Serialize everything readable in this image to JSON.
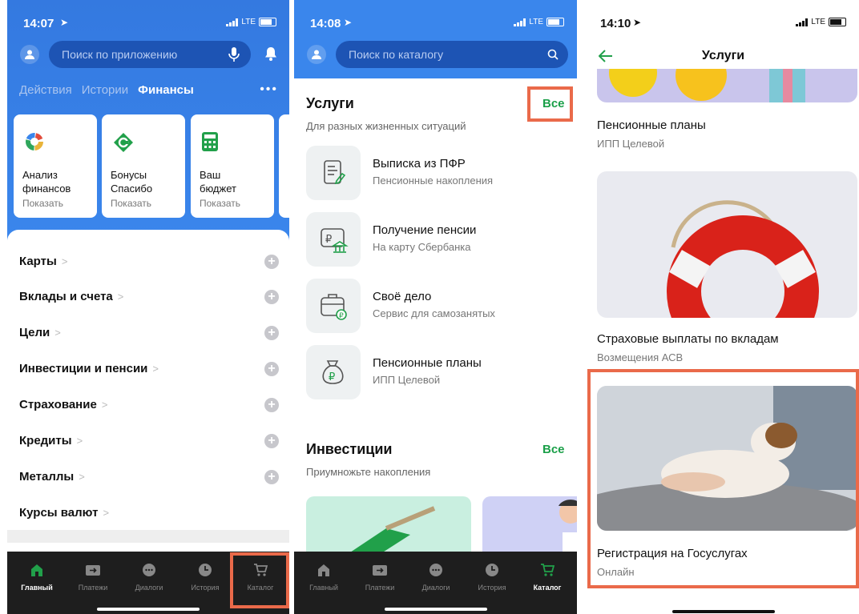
{
  "colors": {
    "accent": "#1a9f48",
    "blue": "#3a86ec",
    "highlight": "#ea6a4a",
    "tabbar": "#1e1e1e"
  },
  "panel1": {
    "status": {
      "time": "14:07",
      "network": "LTE"
    },
    "search": {
      "placeholder": "Поиск по приложению",
      "icons": [
        "user-icon",
        "mic-icon",
        "bell-icon"
      ]
    },
    "tabs": [
      {
        "label": "Действия"
      },
      {
        "label": "Истории"
      },
      {
        "label": "Финансы",
        "active": true
      }
    ],
    "cards": [
      {
        "title": "Анализ финансов",
        "action": "Показать",
        "icon": "pie-chart-icon"
      },
      {
        "title": "Бонусы Спасибо",
        "action": "Показать",
        "icon": "spasibo-icon"
      },
      {
        "title": "Ваш бюджет",
        "action": "Показать",
        "icon": "calculator-icon"
      }
    ],
    "categories": [
      {
        "label": "Карты"
      },
      {
        "label": "Вклады и счета"
      },
      {
        "label": "Цели"
      },
      {
        "label": "Инвестиции и пенсии"
      },
      {
        "label": "Страхование"
      },
      {
        "label": "Кредиты"
      },
      {
        "label": "Металлы"
      },
      {
        "label": "Курсы валют"
      }
    ],
    "tabbar": [
      {
        "label": "Главный",
        "icon": "home-icon",
        "active": true
      },
      {
        "label": "Платежи",
        "icon": "transfer-icon"
      },
      {
        "label": "Диалоги",
        "icon": "chat-icon"
      },
      {
        "label": "История",
        "icon": "clock-icon"
      },
      {
        "label": "Каталог",
        "icon": "cart-icon"
      }
    ]
  },
  "panel2": {
    "status": {
      "time": "14:08",
      "network": "LTE"
    },
    "search": {
      "placeholder": "Поиск по каталогу"
    },
    "services": {
      "title": "Услуги",
      "subtitle": "Для разных жизненных ситуаций",
      "all": "Все",
      "items": [
        {
          "title": "Выписка из ПФР",
          "subtitle": "Пенсионные накопления",
          "icon": "document-icon"
        },
        {
          "title": "Получение пенсии",
          "subtitle": "На карту Сбербанка",
          "icon": "pension-bank-icon"
        },
        {
          "title": "Своё дело",
          "subtitle": "Сервис для самозанятых",
          "icon": "briefcase-icon"
        },
        {
          "title": "Пенсионные планы",
          "subtitle": "ИПП Целевой",
          "icon": "money-bag-icon"
        }
      ]
    },
    "investments": {
      "title": "Инвестиции",
      "subtitle": "Приумножьте накопления",
      "all": "Все"
    },
    "tabbar": [
      {
        "label": "Главный",
        "icon": "home-icon"
      },
      {
        "label": "Платежи",
        "icon": "transfer-icon"
      },
      {
        "label": "Диалоги",
        "icon": "chat-icon"
      },
      {
        "label": "История",
        "icon": "clock-icon"
      },
      {
        "label": "Каталог",
        "icon": "cart-icon",
        "active": true
      }
    ]
  },
  "panel3": {
    "status": {
      "time": "14:10",
      "network": "LTE"
    },
    "header": {
      "title": "Услуги"
    },
    "items": [
      {
        "title": "Пенсионные планы",
        "subtitle": "ИПП Целевой"
      },
      {
        "title": "Страховые выплаты по вкладам",
        "subtitle": "Возмещения АСВ"
      },
      {
        "title": "Регистрация на Госуслугах",
        "subtitle": "Онлайн"
      }
    ]
  }
}
